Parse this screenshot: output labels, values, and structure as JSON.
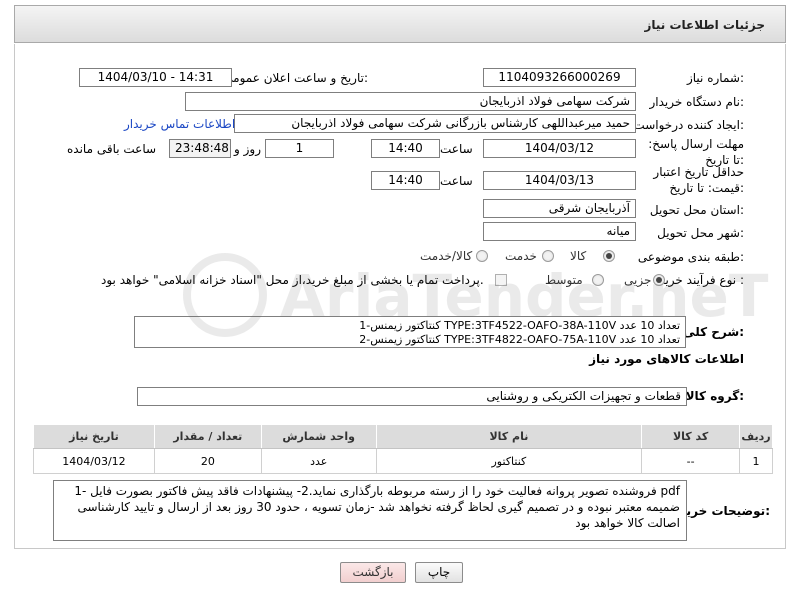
{
  "panel": {
    "title": "جزئیات اطلاعات نیاز"
  },
  "labels": {
    "need_number": "شماره نیاز:",
    "announce_datetime": "تاریخ و ساعت اعلان عمومی:",
    "buyer_org": "نام دستگاه خریدار:",
    "requester": "ایجاد کننده درخواست:",
    "reply_deadline": "مهلت ارسال پاسخ: تا تاریخ:",
    "time": "ساعت",
    "day_and": "روز و",
    "hours_left": "ساعت باقی مانده",
    "price_validity": "حداقل تاریخ اعتبار قیمت: تا تاریخ:",
    "delivery_province": "استان محل تحویل:",
    "delivery_city": "شهر محل تحویل:",
    "category": "طبقه بندی موضوعی:",
    "process_type": "نوع فرآیند خرید :",
    "need_description": "شرح کلی نیاز:",
    "goods_info": "اطلاعات کالاهای مورد نیاز",
    "goods_group": "گروه کالا:",
    "buyer_notes": "توضیحات خریدار:"
  },
  "fields": {
    "need_number": "1104093266000269",
    "announce_datetime": "1404/03/10 - 14:31",
    "buyer_org": "شرکت سهامی فولاد اذربایجان",
    "requester": "حمید میرعبداللهی کارشناس بازرگانی شرکت سهامی فولاد اذربایجان",
    "contact_link": "اطلاعات تماس خریدار",
    "reply_date": "1404/03/12",
    "reply_time": "14:40",
    "reply_days": "1",
    "reply_remaining": "23:48:48",
    "validity_date": "1404/03/13",
    "validity_time": "14:40",
    "province": "آذربایجان شرقی",
    "city": "میانه",
    "goods_group": "قطعات و تجهیزات الکتریکی و روشنایی"
  },
  "category_options": [
    {
      "label": "کالا",
      "selected": true
    },
    {
      "label": "خدمت",
      "selected": false
    },
    {
      "label": "کالا/خدمت",
      "selected": false
    }
  ],
  "process_options": [
    {
      "label": "جزیی",
      "selected": true
    },
    {
      "label": "متوسط",
      "selected": false
    }
  ],
  "payment_note": "پرداخت تمام یا بخشی از مبلغ خرید،از محل \"اسناد خزانه اسلامی\" خواهد بود.",
  "description_lines": [
    "1-کنتاکتور زیمنس TYPE:3TF4522-OAFO-38A-110V تعداد 10 عدد",
    "2-کنتاکتور زیمنس TYPE:3TF4822-OAFO-75A-110V تعداد 10 عدد"
  ],
  "table": {
    "headers": [
      "ردیف",
      "کد کالا",
      "نام کالا",
      "واحد شمارش",
      "تعداد / مقدار",
      "تاریخ نیاز"
    ],
    "rows": [
      [
        "1",
        "--",
        "کنتاکتور",
        "عدد",
        "20",
        "1404/03/12"
      ]
    ]
  },
  "buyer_notes_lines": [
    "1- فروشنده تصویر پروانه فعالیت خود را از رسته مربوطه بارگذاری نماید.2- پیشنهادات فاقد پیش فاکتور بصورت فایل pdf",
    "ضمیمه معتبر نبوده و در تصمیم گیری لحاظ گرفته نخواهد شد -زمان تسویه ، حدود 30 روز بعد از ارسال و تایید کارشناسی",
    "اصالت کالا خواهد بود"
  ],
  "buttons": {
    "print": "چاپ",
    "back": "بازگشت"
  },
  "watermark": "AriaTender.neT",
  "colors": {
    "link": "#1b47c4",
    "header_bg": "#dcdcdc",
    "back_button": "#f2cfcf"
  }
}
